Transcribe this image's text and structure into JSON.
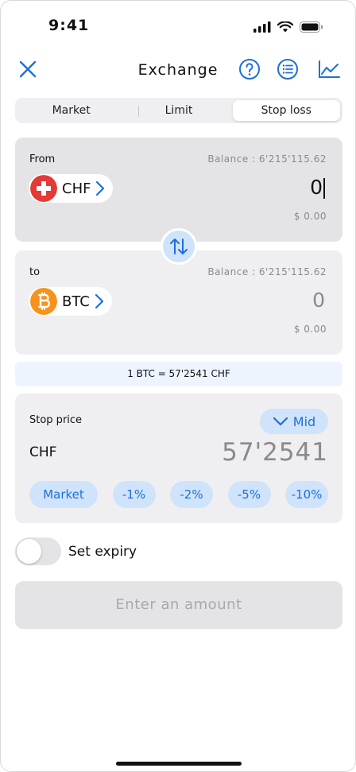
{
  "status_bar": {
    "time": "9:41"
  },
  "header": {
    "title": "Exchange",
    "icons": [
      "close-icon",
      "help-icon",
      "list-icon",
      "chart-icon"
    ],
    "accent_color": "#1f6fd8"
  },
  "tabs": [
    {
      "label": "Market",
      "active": false
    },
    {
      "label": "Limit",
      "active": false
    },
    {
      "label": "Stop loss",
      "active": true
    }
  ],
  "from": {
    "label": "From",
    "balance": "Balance : 6'215'115.62",
    "currency": "CHF",
    "amount": "0",
    "usd_value": "$ 0.00",
    "icon": "swiss-flag-icon",
    "icon_color": "#e53935"
  },
  "to": {
    "label": "to",
    "balance": "Balance : 6'215'115.62",
    "currency": "BTC",
    "amount": "0",
    "usd_value": "$ 0.00",
    "icon": "bitcoin-icon",
    "icon_color": "#f7931a"
  },
  "rate": "1 BTC = 57'2541 CHF",
  "stop": {
    "label": "Stop price",
    "mid_label": "Mid",
    "currency": "CHF",
    "value": "57'2541",
    "presets": [
      "Market",
      "-1%",
      "-2%",
      "-5%",
      "-10%"
    ]
  },
  "expiry": {
    "label": "Set expiry",
    "enabled": false
  },
  "cta": {
    "label": "Enter an amount"
  }
}
